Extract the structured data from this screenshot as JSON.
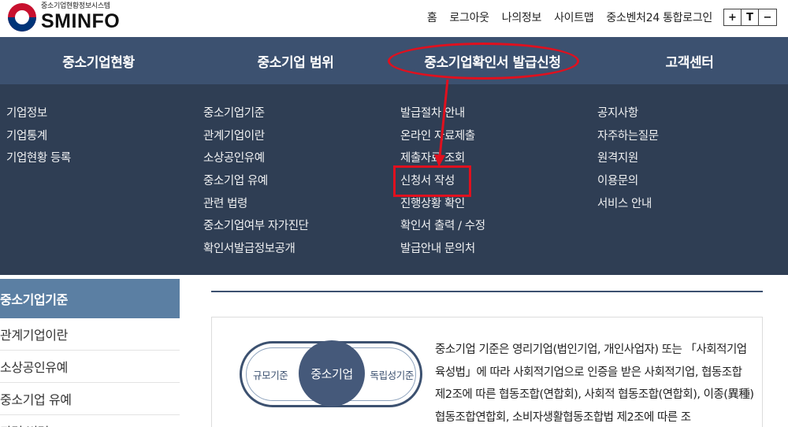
{
  "logo": {
    "subtitle": "중소기업현황정보시스템",
    "name": "SMINFO"
  },
  "util_links": [
    "홈",
    "로그아웃",
    "나의정보",
    "사이트맵",
    "중소벤처24 통합로그인"
  ],
  "font_controls": [
    "+",
    "T",
    "−"
  ],
  "gnb": [
    "중소기업현황",
    "중소기업 범위",
    "중소기업확인서 발급신청",
    "고객센터"
  ],
  "mega": [
    [
      "기업정보",
      "기업통계",
      "기업현황 등록"
    ],
    [
      "중소기업기준",
      "관계기업이란",
      "소상공인유예",
      "중소기업 유예",
      "관련 법령",
      "중소기업여부 자가진단",
      "확인서발급정보공개"
    ],
    [
      "발급절차 안내",
      "온라인 자료제출",
      "제출자료 조회",
      "신청서 작성",
      "진행상황 확인",
      "확인서 출력 / 수정",
      "발급안내 문의처"
    ],
    [
      "공지사항",
      "자주하는질문",
      "원격지원",
      "이용문의",
      "서비스 안내"
    ]
  ],
  "lnb": [
    "중소기업기준",
    "관계기업이란",
    "소상공인유예",
    "중소기업 유예",
    "관련 법령"
  ],
  "pill": {
    "left": "규모기준",
    "center": "중소기업",
    "right": "독립성기준"
  },
  "description": "중소기업 기준은 영리기업(법인기업, 개인사업자) 또는 「사회적기업 육성법」에 따라 사회적기업으로 인증을 받은 사회적기업, 협동조합 제2조에 따른 협동조합(연합회), 사회적 협동조합(연합회), 이종(異種)협동조합연합회, 소비자생활협동조합법 제2조에 따른 조",
  "colors": {
    "nav": "#3c5170",
    "mega": "#2f3e54",
    "active": "#5b7fa3",
    "annotation": "#e0101e"
  }
}
